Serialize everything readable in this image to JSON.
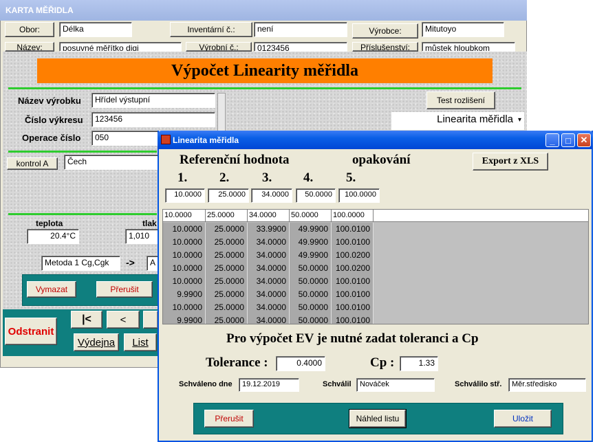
{
  "back_window": {
    "title": "KARTA MĚŘIDLA",
    "obor_btn": "Obor:",
    "obor_val": "Délka",
    "inventarni_btn": "Inventární č.:",
    "inventarni_val": "není",
    "vyrobce_btn": "Výrobce:",
    "vyrobce_val": "Mitutoyo",
    "nazev_btn": "Název:",
    "nazev_val": "posuvné měřítko digi",
    "vyrobni_btn": "Výrobní č.:",
    "vyrobni_val": "0123456",
    "prislusenstvi_btn": "Příslušenství:",
    "prislusenstvi_val": "můstek hloubkom"
  },
  "linearity_panel": {
    "title": "Výpočet Linearity měřidla",
    "nazev_vyrobku_label": "Název výrobku",
    "nazev_vyrobku_val": "Hřídel výstupní",
    "cislo_vykresu_label": "Číslo výkresu",
    "cislo_vykresu_val": "123456",
    "operace_label": "Operace číslo",
    "operace_val": "050",
    "kontrol_btn": "kontrol A",
    "kontrol_val": "Čech",
    "teplota_label": "teplota",
    "teplota_val": "20.4°C",
    "tlak_label": "tlak",
    "tlak_val": "1,010",
    "metoda_val": "Metoda 1 Cg,Cgk",
    "arrow": "->",
    "metoda2_val": "A",
    "vymazat_btn": "Vymazat",
    "prerusit_btn": "Přerušit",
    "test_btn": "Test rozlišení",
    "linearita_select": "Linearita měřidla",
    "odstranit_btn": "Odstranit",
    "nav_first": "|<",
    "nav_prev": "<",
    "vydejna_btn": "Výdejna",
    "list_btn": "List"
  },
  "dialog": {
    "title": "Linearita měřidla",
    "ref_label": "Referenční hodnota",
    "opak_label": "opakování",
    "export_btn": "Export z XLS",
    "col_nums": [
      "1.",
      "2.",
      "3.",
      "4.",
      "5."
    ],
    "ref_values": [
      "10.0000",
      "25.0000",
      "34.0000",
      "50.0000",
      "100.0000"
    ],
    "table_headers": [
      "10.0000",
      "25.0000",
      "34.0000",
      "50.0000",
      "100.0000"
    ],
    "table_rows": [
      [
        "10.0000",
        "25.0000",
        "33.9900",
        "49.9900",
        "100.0100"
      ],
      [
        "10.0000",
        "25.0000",
        "34.0000",
        "49.9900",
        "100.0100"
      ],
      [
        "10.0000",
        "25.0000",
        "34.0000",
        "49.9900",
        "100.0200"
      ],
      [
        "10.0000",
        "25.0000",
        "34.0000",
        "50.0000",
        "100.0200"
      ],
      [
        "10.0000",
        "25.0000",
        "34.0000",
        "50.0000",
        "100.0100"
      ],
      [
        "9.9900",
        "25.0000",
        "34.0000",
        "50.0000",
        "100.0100"
      ],
      [
        "10.0000",
        "25.0000",
        "34.0000",
        "50.0000",
        "100.0100"
      ],
      [
        "9.9900",
        "25.0000",
        "34.0000",
        "50.0000",
        "100.0100"
      ]
    ],
    "ev_message": "Pro výpočet EV je nutné zadat toleranci a Cp",
    "tolerance_label": "Tolerance :",
    "tolerance_val": "0.4000",
    "cp_label": "Cp :",
    "cp_val": "1.33",
    "schvaleno_label": "Schváleno dne",
    "schvaleno_val": "19.12.2019",
    "schvalil_label": "Schválil",
    "schvalil_val": "Nováček",
    "schvalilo_label": "Schválilo stř.",
    "schvalilo_val": "Měr.středisko",
    "prerusit_btn": "Přerušit",
    "nahled_btn": "Náhled listu",
    "ulozit_btn": "Uložit"
  },
  "colors": {
    "orange": "#ff7f00",
    "teal": "#0f7f7f",
    "red_text": "#c00000",
    "xp_blue": "#0054e3"
  }
}
